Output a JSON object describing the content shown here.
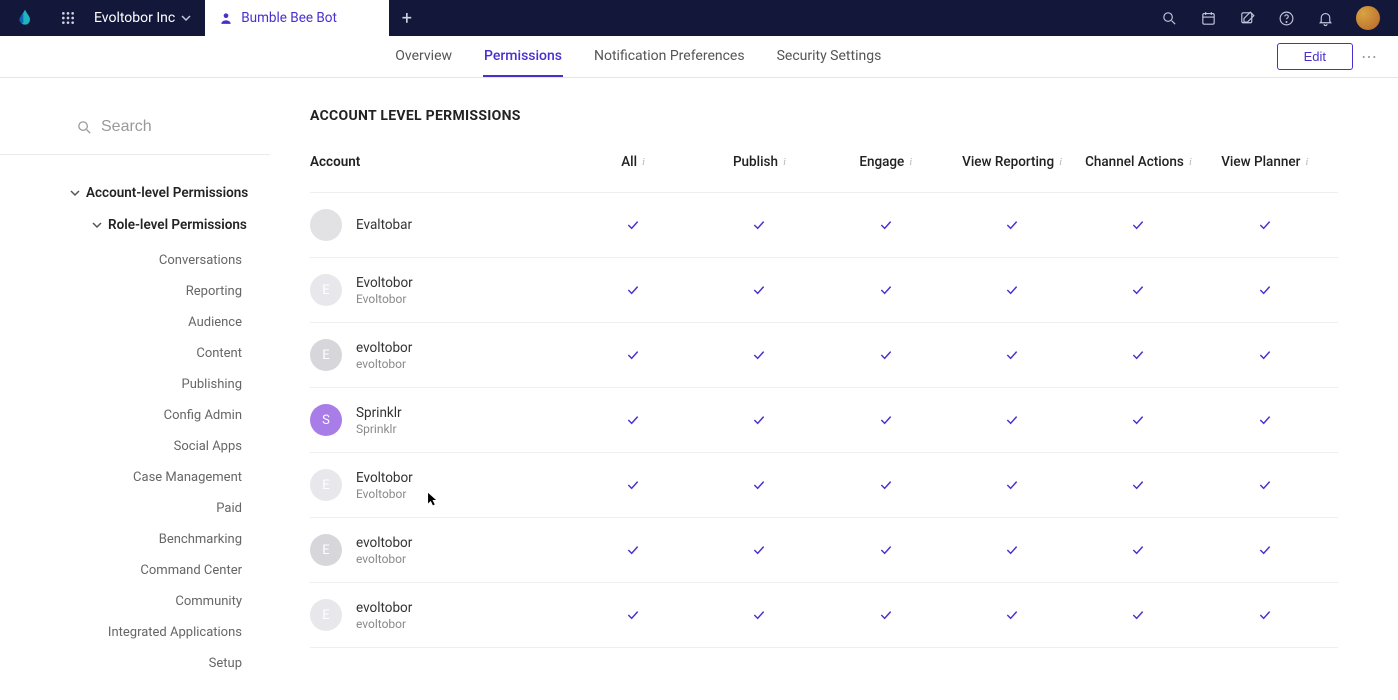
{
  "header": {
    "workspace_name": "Evoltobor Inc",
    "active_tab_label": "Bumble Bee Bot"
  },
  "subnav": {
    "tabs": [
      "Overview",
      "Permissions",
      "Notification Preferences",
      "Security Settings"
    ],
    "active_index": 1,
    "edit_label": "Edit"
  },
  "search": {
    "placeholder": "Search"
  },
  "sidebar": {
    "section_account": "Account-level Permissions",
    "section_role": "Role-level Permissions",
    "items": [
      "Conversations",
      "Reporting",
      "Audience",
      "Content",
      "Publishing",
      "Config Admin",
      "Social Apps",
      "Case Management",
      "Paid",
      "Benchmarking",
      "Command Center",
      "Community",
      "Integrated Applications",
      "Setup"
    ]
  },
  "content": {
    "section_title": "ACCOUNT LEVEL PERMISSIONS",
    "columns": [
      "Account",
      "All",
      "Publish",
      "Engage",
      "View Reporting",
      "Channel Actions",
      "View Planner"
    ],
    "rows": [
      {
        "avatar_letter": "",
        "avatar_class": "blank",
        "primary": "Evaltobar",
        "secondary": "",
        "checks": [
          true,
          true,
          true,
          true,
          true,
          true
        ]
      },
      {
        "avatar_letter": "E",
        "avatar_class": "light",
        "primary": "Evoltobor",
        "secondary": "Evoltobor",
        "checks": [
          true,
          true,
          true,
          true,
          true,
          true
        ]
      },
      {
        "avatar_letter": "E",
        "avatar_class": "",
        "primary": "evoltobor",
        "secondary": "evoltobor",
        "checks": [
          true,
          true,
          true,
          true,
          true,
          true
        ]
      },
      {
        "avatar_letter": "S",
        "avatar_class": "purple",
        "primary": "Sprinklr",
        "secondary": "Sprinklr",
        "checks": [
          true,
          true,
          true,
          true,
          true,
          true
        ]
      },
      {
        "avatar_letter": "E",
        "avatar_class": "light",
        "primary": "Evoltobor",
        "secondary": "Evoltobor",
        "checks": [
          true,
          true,
          true,
          true,
          true,
          true
        ]
      },
      {
        "avatar_letter": "E",
        "avatar_class": "",
        "primary": "evoltobor",
        "secondary": "evoltobor",
        "checks": [
          true,
          true,
          true,
          true,
          true,
          true
        ]
      },
      {
        "avatar_letter": "E",
        "avatar_class": "light",
        "primary": "evoltobor",
        "secondary": "evoltobor",
        "checks": [
          true,
          true,
          true,
          true,
          true,
          true
        ]
      }
    ]
  }
}
